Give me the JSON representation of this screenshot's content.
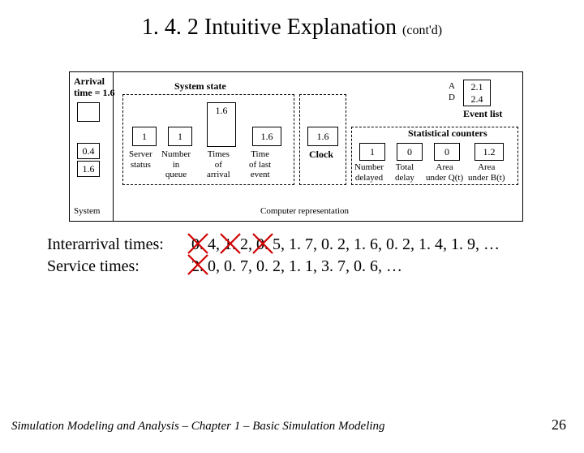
{
  "title_main": "1. 4. 2  Intuitive Explanation ",
  "title_contd": "(cont'd)",
  "diagram": {
    "arrival_time_label": "Arrival\ntime = 1.6",
    "system_label": "System",
    "server_status_label": "Server\nstatus",
    "number_in_queue_label": "Number\nin\nqueue",
    "times_of_arrival_label": "Times\nof\narrival",
    "time_of_last_event_label": "Time\nof last\nevent",
    "system_state_label": "System state",
    "clock_label": "Clock",
    "event_list_label": "Event list",
    "event_A": "A",
    "event_D": "D",
    "event_A_val": "2.1",
    "event_D_val": "2.4",
    "statistical_counters_label": "Statistical counters",
    "number_delayed_label": "Number\ndelayed",
    "total_delay_label": "Total\ndelay",
    "area_under_Q_label": "Area\nunder Q(t)",
    "area_under_B_label": "Area\nunder B(t)",
    "computer_representation_label": "Computer representation",
    "box_queue1": "0.4",
    "box_queue2": "1.6",
    "server_status": "1",
    "num_in_queue": "1",
    "arrival0": "1.6",
    "last_event": "1.6",
    "clock_val": "1.6",
    "num_delayed": "1",
    "total_delay": "0",
    "area_Q": "0",
    "area_B": "1.2"
  },
  "interarrival_label": "Interarrival times:",
  "service_label": "Service times:",
  "interarrival_values": "0. 4, 1. 2, 0. 5, 1. 7, 0. 2, 1. 6, 0. 2, 1. 4, 1. 9, …",
  "service_values": "2. 0, 0. 7, 0. 2, 1. 1, 3. 7, 0. 6, …",
  "footer": "Simulation Modeling and Analysis – Chapter 1 –  Basic Simulation Modeling",
  "page_number": "26"
}
